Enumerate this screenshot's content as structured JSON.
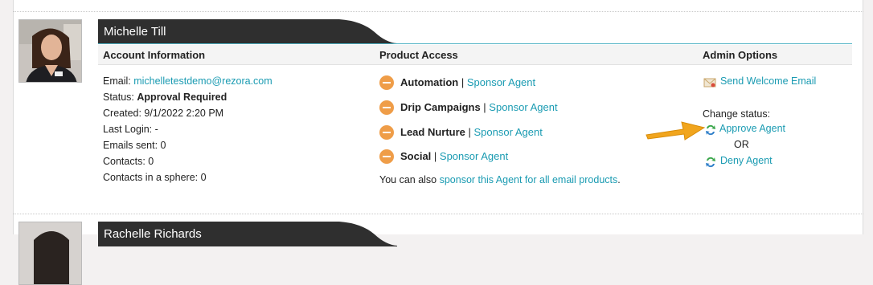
{
  "agents": [
    {
      "name": "Michelle Till",
      "columns": {
        "account": "Account Information",
        "product": "Product Access",
        "admin": "Admin Options"
      },
      "account": {
        "email_label": "Email: ",
        "email": "michelletestdemo@rezora.com",
        "status_label": "Status: ",
        "status": "Approval Required",
        "created": "Created: 9/1/2022 2:20 PM",
        "last_login": "Last Login: -",
        "emails_sent": "Emails sent: 0",
        "contacts": "Contacts: 0",
        "sphere": "Contacts in a sphere: 0"
      },
      "products": [
        {
          "name": "Automation",
          "sep": " | ",
          "link": "Sponsor Agent"
        },
        {
          "name": "Drip Campaigns",
          "sep": " | ",
          "link": "Sponsor Agent"
        },
        {
          "name": "Lead Nurture",
          "sep": " | ",
          "link": "Sponsor Agent"
        },
        {
          "name": "Social",
          "sep": " | ",
          "link": "Sponsor Agent"
        }
      ],
      "sponsor_all": {
        "prefix": "You can also ",
        "link": "sponsor this Agent for all email products",
        "suffix": "."
      },
      "admin": {
        "welcome": "Send Welcome Email",
        "change_status": "Change status:",
        "approve": "Approve Agent",
        "or": "OR",
        "deny": "Deny Agent"
      }
    },
    {
      "name": "Rachelle Richards"
    }
  ],
  "icons": {
    "welcome": "envelope-icon",
    "approve": "status-swap-icon",
    "deny": "status-swap-icon",
    "product": "minus-circle-icon",
    "callout": "arrow-callout-icon"
  },
  "colors": {
    "link": "#1a9bb2",
    "tab": "#2f2f2f",
    "minus": "#ef9d48",
    "arrow": "#f1a51d"
  }
}
